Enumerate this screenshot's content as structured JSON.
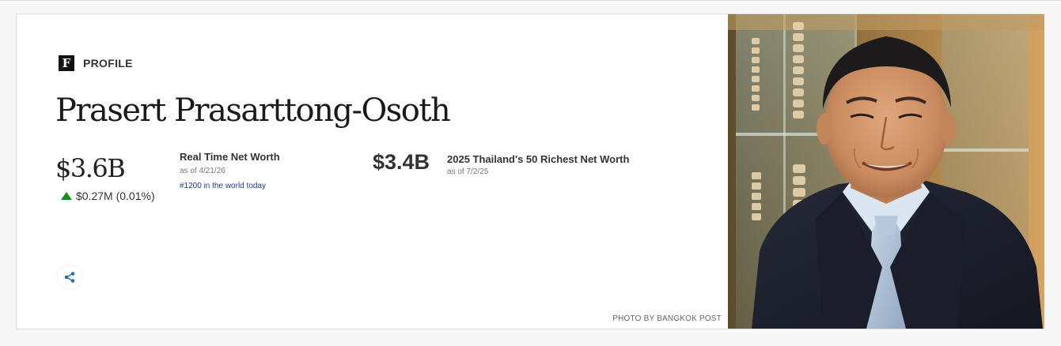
{
  "header": {
    "logo_letter": "F",
    "section_label": "PROFILE"
  },
  "person": {
    "name": "Prasert Prasarttong-Osoth"
  },
  "real_time": {
    "value": "$3.6B",
    "change": "$0.27M (0.01%)",
    "change_direction": "up",
    "label": "Real Time Net Worth",
    "as_of": "as of 4/21/26",
    "rank": "#1200 in the world today"
  },
  "list_worth": {
    "value": "$3.4B",
    "label": "2025 Thailand's 50 Richest Net Worth",
    "as_of": "as of 7/2/25"
  },
  "share": {
    "icon": "share-icon"
  },
  "photo": {
    "credit": "PHOTO BY BANGKOK POST"
  },
  "colors": {
    "up": "#1c8a1c",
    "link": "#1d3f87",
    "share_icon": "#1d6fa5"
  }
}
